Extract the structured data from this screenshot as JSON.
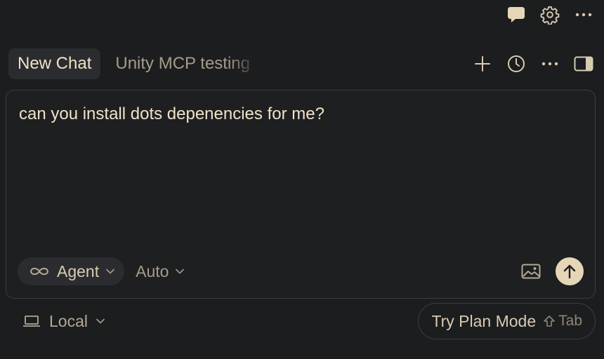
{
  "window": {
    "top_icons": [
      "chat-bubble-icon",
      "gear-icon",
      "more-horizontal-icon"
    ]
  },
  "tabs": [
    {
      "label": "New Chat",
      "active": true
    },
    {
      "label": "Unity MCP testing",
      "active": false
    }
  ],
  "tab_actions": [
    "plus-icon",
    "history-clock-icon",
    "more-horizontal-icon",
    "toggle-panel-icon"
  ],
  "composer": {
    "text": "can you install dots depenencies for me?",
    "mode": {
      "label": "Agent",
      "icon": "infinity-icon"
    },
    "model": {
      "label": "Auto"
    },
    "attach_icon": "image-icon",
    "send_icon": "arrow-up-icon"
  },
  "footer": {
    "environment": {
      "label": "Local",
      "icon": "laptop-icon"
    },
    "plan_mode": {
      "label": "Try Plan Mode",
      "shortcut": "Tab"
    }
  },
  "colors": {
    "background": "#1c1d1f",
    "surface": "#2b2c2f",
    "border": "#3c3d40",
    "text": "#efe2c8",
    "muted": "#a59c8b",
    "accent": "#e6d6b8"
  }
}
